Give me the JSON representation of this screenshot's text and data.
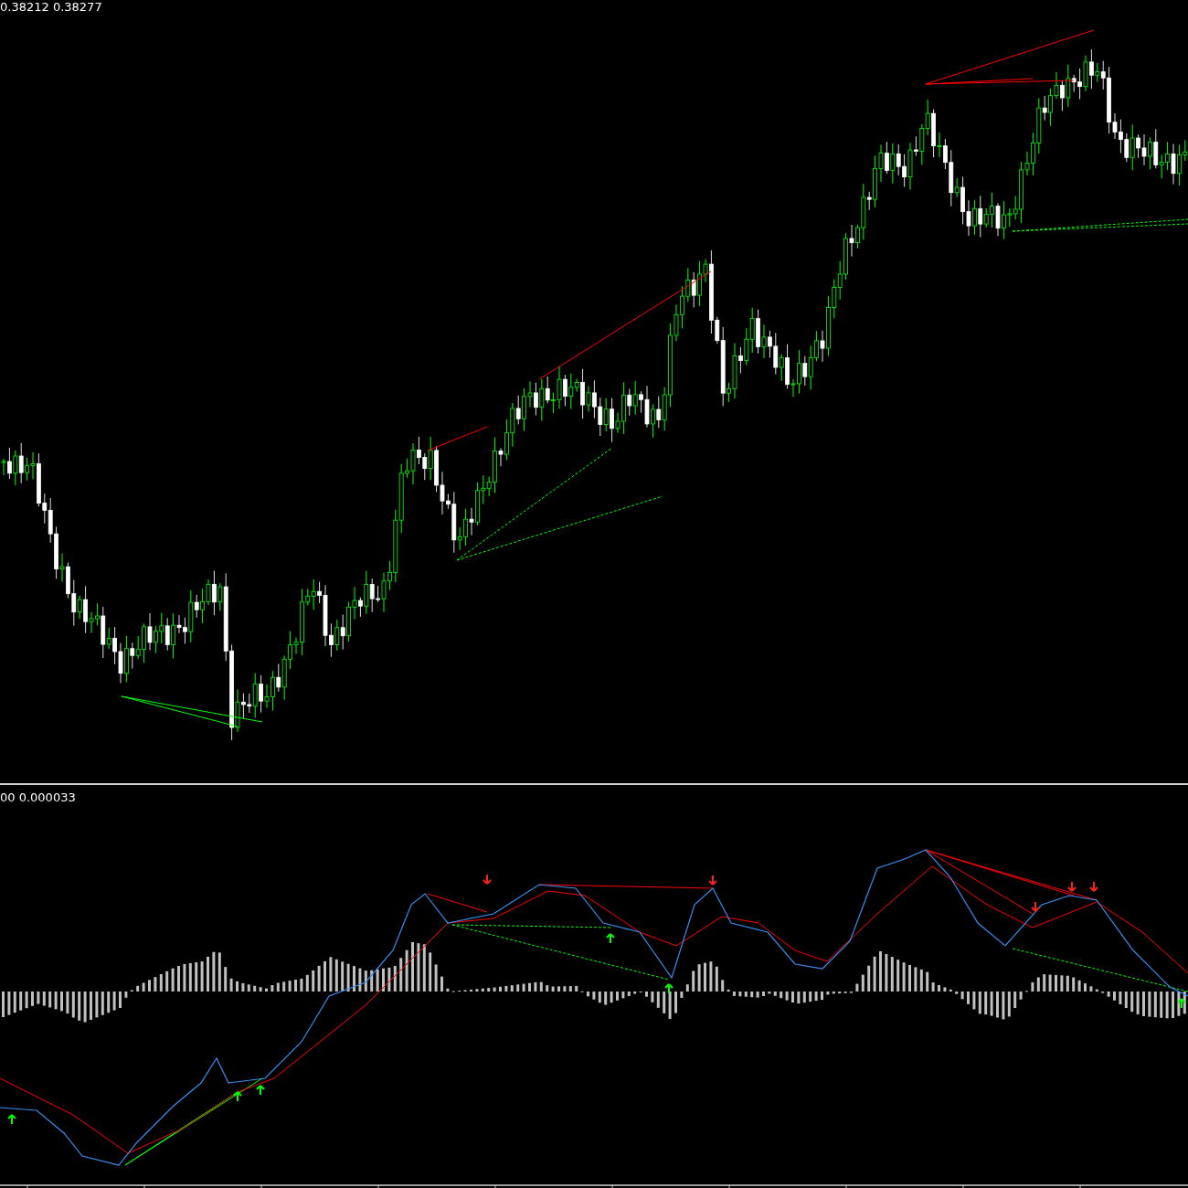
{
  "price_pane": {
    "header": "0.38212 0.38277"
  },
  "indicator_pane": {
    "header": "00 0.000033"
  }
}
